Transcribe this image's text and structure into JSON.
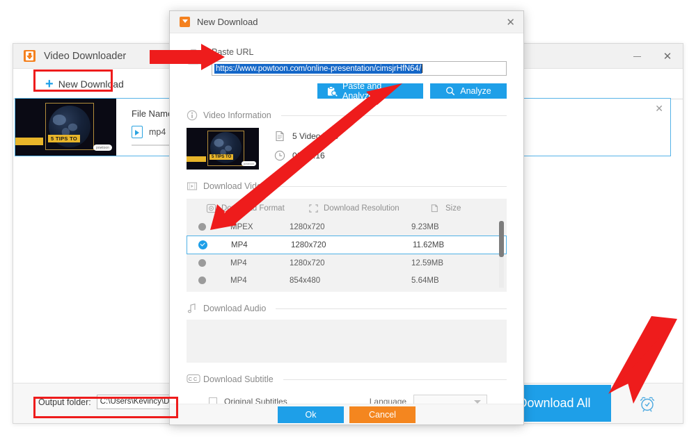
{
  "main_window": {
    "title": "Video Downloader",
    "logo_icon": "app-logo-icon",
    "minimize_icon": "minimize-icon",
    "close_icon": "close-icon",
    "toolbar": {
      "new_download_label": "New Download",
      "plus_icon": "plus-icon",
      "info_text": "i"
    },
    "download_item": {
      "file_name_label": "File Name:",
      "format_label": "mp4",
      "format_icon": "video-file-icon",
      "close_icon": "close-icon",
      "thumbnail_caption": "5 TIPS TO",
      "thumbnail_badge": "powtoon"
    },
    "bottom": {
      "output_folder_label": "Output folder:",
      "output_folder_value": "C:\\Users\\Kevincy\\Desktop\\Co",
      "download_all_label": "Download All",
      "alarm_icon": "alarm-clock-icon"
    }
  },
  "dialog": {
    "title": "New Download",
    "logo_icon": "app-logo-icon",
    "close_icon": "close-icon",
    "paste": {
      "icon": "clipboard-paste-icon",
      "label": "Paste URL",
      "url_value": "https://www.powtoon.com/online-presentation/cimsjrHfN64/",
      "paste_analyze_label": "Paste and Analyze",
      "paste_analyze_icon": "clipboard-search-icon",
      "analyze_label": "Analyze",
      "analyze_icon": "search-icon"
    },
    "video_information": {
      "section_label": "Video Information",
      "section_icon": "info-icon",
      "title": "5 Video Tips",
      "title_icon": "document-icon",
      "duration": "00:01:16",
      "duration_icon": "clock-icon",
      "thumbnail_caption": "5 TIPS TO",
      "thumbnail_badge": "powtoon"
    },
    "download_video": {
      "section_label": "Download Video",
      "section_icon": "film-icon",
      "columns": [
        {
          "label": "Download Format",
          "icon": "video-format-icon"
        },
        {
          "label": "Download Resolution",
          "icon": "crop-frame-icon"
        },
        {
          "label": "Size",
          "icon": "file-size-icon"
        }
      ],
      "rows": [
        {
          "format": "MPEX",
          "resolution": "1280x720",
          "size": "9.23MB",
          "selected": false
        },
        {
          "format": "MP4",
          "resolution": "1280x720",
          "size": "11.62MB",
          "selected": true
        },
        {
          "format": "MP4",
          "resolution": "1280x720",
          "size": "12.59MB",
          "selected": false
        },
        {
          "format": "MP4",
          "resolution": "854x480",
          "size": "5.64MB",
          "selected": false
        }
      ]
    },
    "download_audio": {
      "section_label": "Download Audio",
      "section_icon": "music-note-icon"
    },
    "download_subtitle": {
      "section_label": "Download Subtitle",
      "section_icon": "cc-icon",
      "original_subtitles_label": "Original Subtitles",
      "language_label": "Language",
      "language_value": ""
    },
    "footer": {
      "ok_label": "Ok",
      "cancel_label": "Cancel"
    }
  },
  "colors": {
    "accent_blue": "#1e9fe8",
    "orange": "#f4861f",
    "annotation_red": "#ee1c1c",
    "selection_blue": "#1467c8"
  }
}
